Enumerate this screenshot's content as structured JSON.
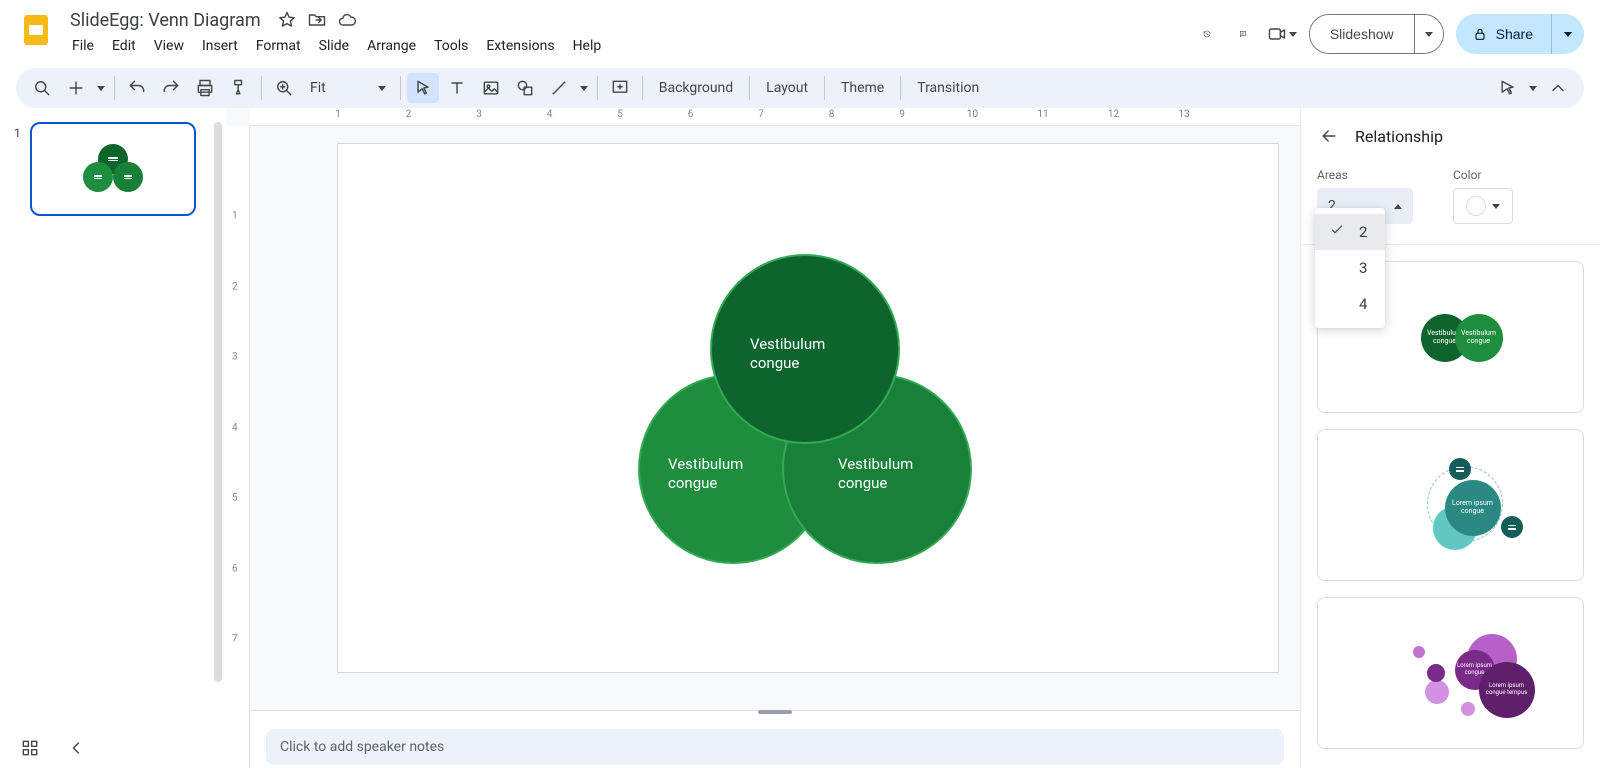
{
  "doc_title": "SlideEgg: Venn Diagram",
  "menus": [
    "File",
    "Edit",
    "View",
    "Insert",
    "Format",
    "Slide",
    "Arrange",
    "Tools",
    "Extensions",
    "Help"
  ],
  "header": {
    "slideshow": "Slideshow",
    "share": "Share"
  },
  "toolbar": {
    "zoom_label": "Fit",
    "background": "Background",
    "layout": "Layout",
    "theme": "Theme",
    "transition": "Transition"
  },
  "ruler_h": [
    "1",
    "2",
    "3",
    "4",
    "5",
    "6",
    "7",
    "8",
    "9",
    "10",
    "11",
    "12",
    "13"
  ],
  "ruler_v": [
    "1",
    "2",
    "3",
    "4",
    "5",
    "6",
    "7"
  ],
  "slide": {
    "number": "1",
    "circles": [
      {
        "text1": "Vestibulum",
        "text2": "congue"
      },
      {
        "text1": "Vestibulum",
        "text2": "congue"
      },
      {
        "text1": "Vestibulum",
        "text2": "congue"
      }
    ]
  },
  "notes_placeholder": "Click to add speaker notes",
  "right_panel": {
    "title": "Relationship",
    "areas_label": "Areas",
    "color_label": "Color",
    "areas_value": "2",
    "areas_options": [
      "2",
      "3",
      "4"
    ],
    "template2_label": "Lorem ipsum congue",
    "template3_label1": "Lorem ipsum congue",
    "template3_label2": "Lorem ipsum congue tempus",
    "t1_label_a": "Vestibulum congue",
    "t1_label_b": "Vestibulum congue"
  },
  "colors": {
    "venn_top": "#0d652d",
    "venn_left": "#1e8e3e",
    "venn_right": "#188038",
    "venn_border": "#34a853"
  }
}
